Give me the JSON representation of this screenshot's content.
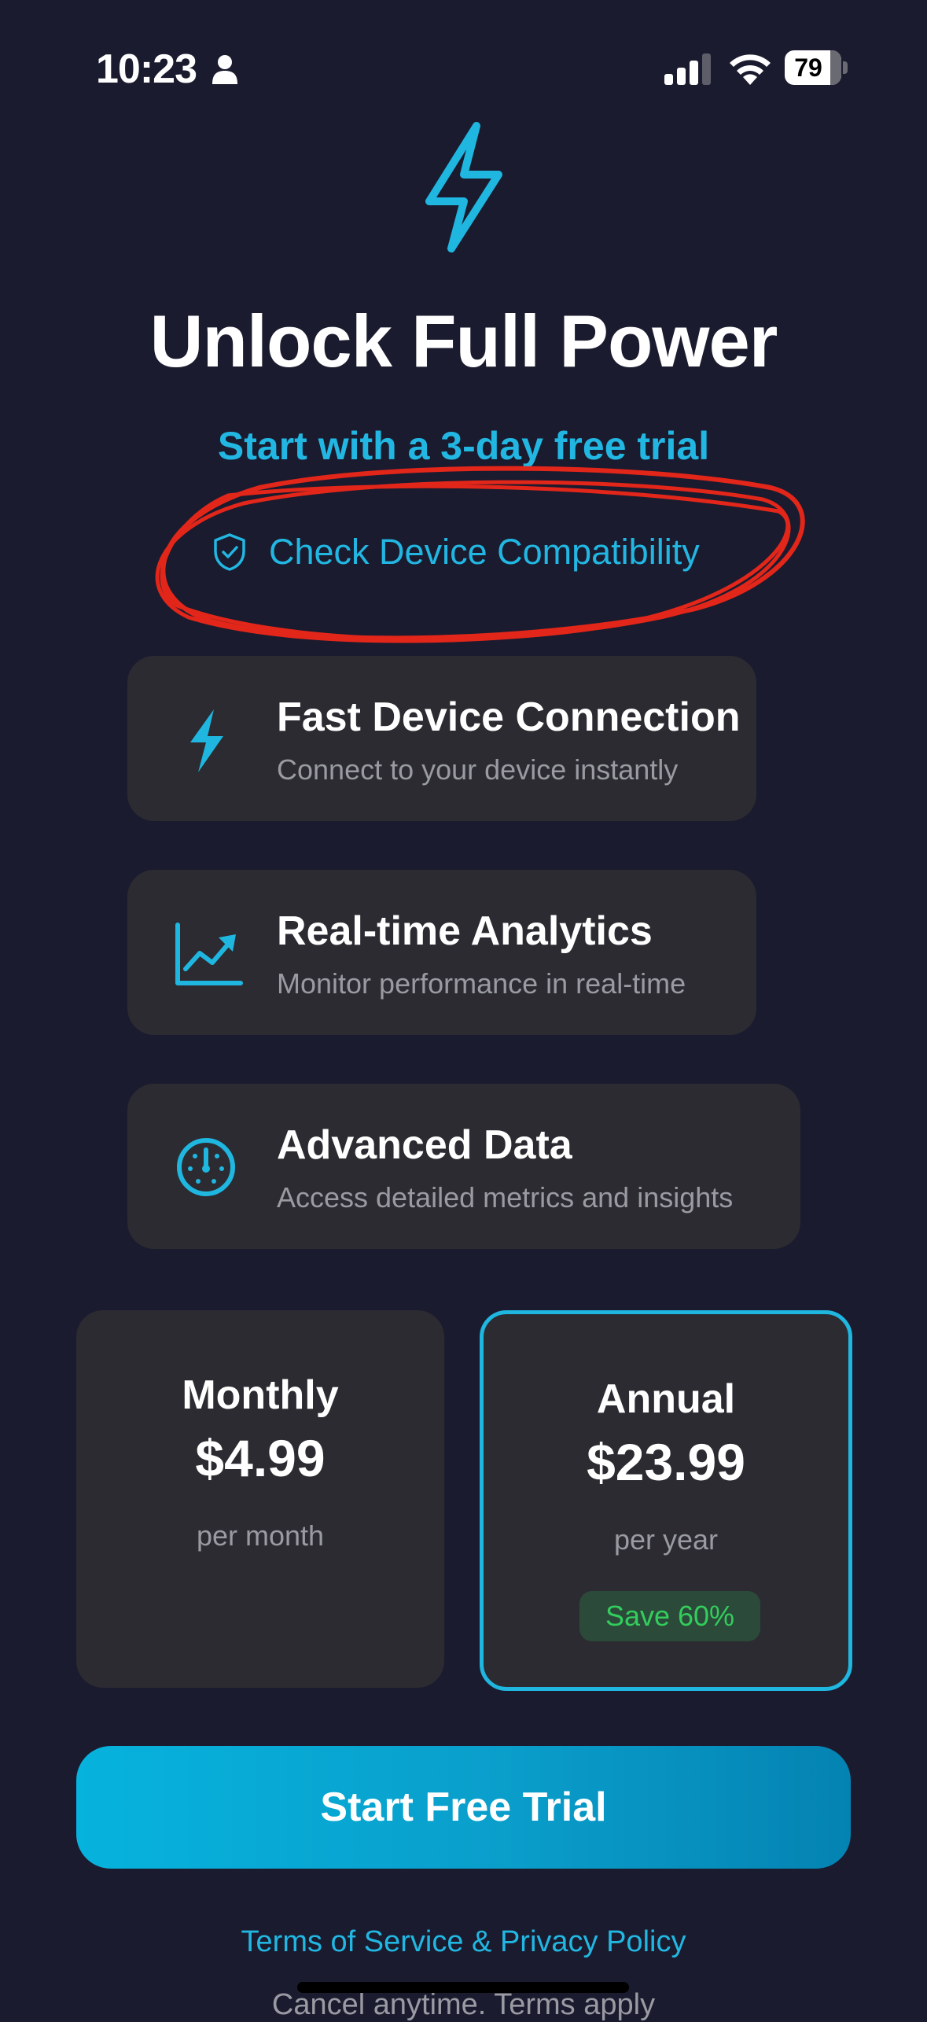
{
  "status_bar": {
    "time": "10:23",
    "battery": "79",
    "icons": [
      "person-icon",
      "signal-icon",
      "wifi-icon",
      "battery-icon"
    ]
  },
  "hero": {
    "icon": "bolt-icon",
    "title": "Unlock Full Power",
    "subtitle": "Start with a 3-day free trial"
  },
  "compatibility": {
    "icon": "shield-check-icon",
    "label": "Check Device Compatibility"
  },
  "features": [
    {
      "icon": "bolt-icon",
      "title": "Fast Device Connection",
      "description": "Connect to your device instantly"
    },
    {
      "icon": "chart-icon",
      "title": "Real-time Analytics",
      "description": "Monitor performance in real-time"
    },
    {
      "icon": "gauge-icon",
      "title": "Advanced Data",
      "description": "Access detailed metrics and insights"
    }
  ],
  "plans": [
    {
      "name": "Monthly",
      "price": "$4.99",
      "period": "per month",
      "selected": false
    },
    {
      "name": "Annual",
      "price": "$23.99",
      "period": "per year",
      "badge": "Save 60%",
      "selected": true
    }
  ],
  "cta": {
    "label": "Start Free Trial"
  },
  "footer": {
    "terms": "Terms of Service & Privacy Policy",
    "cancel": "Cancel anytime. Terms apply"
  },
  "colors": {
    "background": "#1a1b2e",
    "accent": "#22b7e2",
    "card": "#2b2b31",
    "save_green": "#32cd5c",
    "annotation_red": "#e2261a"
  }
}
